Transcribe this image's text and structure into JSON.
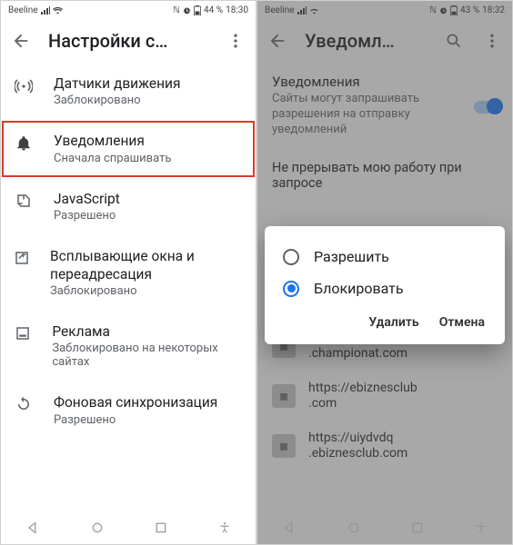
{
  "left": {
    "status": {
      "carrier": "Beeline",
      "batt": "44 %",
      "time": "18:30"
    },
    "title": "Настройки с…",
    "rows": [
      {
        "name": "motion-sensors",
        "icon": "broadcast",
        "primary": "Датчики движения",
        "secondary": "Заблокировано"
      },
      {
        "name": "notifications",
        "icon": "bell",
        "primary": "Уведомления",
        "secondary": "Сначала спрашивать",
        "highlight": true
      },
      {
        "name": "javascript",
        "icon": "script",
        "primary": "JavaScript",
        "secondary": "Разрешено"
      },
      {
        "name": "popups",
        "icon": "popup",
        "primary": "Всплывающие окна и переадресация",
        "secondary": "Заблокировано"
      },
      {
        "name": "ads",
        "icon": "ads",
        "primary": "Реклама",
        "secondary": "Заблокировано на некоторых сайтах"
      },
      {
        "name": "bg-sync",
        "icon": "sync",
        "primary": "Фоновая синхронизация",
        "secondary": "Разрешено"
      }
    ]
  },
  "right": {
    "status": {
      "carrier": "Beeline",
      "batt": "43 %",
      "time": "18:32"
    },
    "title": "Уведомл…",
    "section": {
      "heading": "Уведомления",
      "body": "Сайты могут запрашивать разрешения на отправку уведомлений",
      "toggle_on": true
    },
    "sub_heading": "Не прерывать мою работу при запросе",
    "sites": [
      "https://www.championat.com",
      "https://ebiznesclub.com",
      "https://uiydvdq.ebiznesclub.com"
    ],
    "dialog": {
      "options": [
        {
          "label": "Разрешить",
          "checked": false
        },
        {
          "label": "Блокировать",
          "checked": true
        }
      ],
      "actions": {
        "delete": "Удалить",
        "cancel": "Отмена"
      }
    }
  }
}
